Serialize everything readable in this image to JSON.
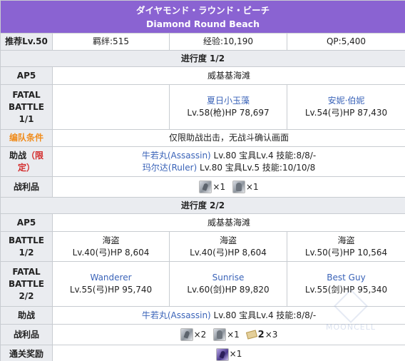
{
  "header": {
    "title_jp": "ダイヤモンド・ラウンド・ビーチ",
    "title_en": "Diamond Round Beach"
  },
  "summary": {
    "recommended_level": "推荐Lv.50",
    "bond": "羁绊:515",
    "exp": "经验:10,190",
    "qp": "QP:5,400"
  },
  "progress1": {
    "title": "进行度 1/2",
    "ap_label": "AP5",
    "location": "威基基海滩",
    "battle_label": [
      "FATAL",
      "BATTLE",
      "1/1"
    ],
    "enemies": [
      {
        "name": "",
        "stats": ""
      },
      {
        "name": "夏日小玉藻",
        "stats": "Lv.58(枪)HP 78,697"
      },
      {
        "name": "安妮·伯妮",
        "stats": "Lv.54(弓)HP 87,430"
      }
    ],
    "formation_label": "编队条件",
    "formation_value": "仅限助战出击，无战斗确认画面",
    "support_label_a": "助战",
    "support_label_b": "（限",
    "support_label_c": "定）",
    "support_lines": [
      {
        "name": "牛若丸(Assassin)",
        "rest": " Lv.80 宝具Lv.4 技能:8/8/-"
      },
      {
        "name": "玛尔达(Ruler)",
        "rest": " Lv.80 宝具Lv.5 技能:10/10/8"
      }
    ],
    "loot_label": "战利品",
    "loot": [
      {
        "icon": "silver-gear-icon",
        "count": "×1"
      },
      {
        "icon": "silver-statue-icon",
        "count": "×1"
      }
    ]
  },
  "progress2": {
    "title": "进行度 2/2",
    "ap_label": "AP5",
    "location": "威基基海滩",
    "battle1_label": [
      "BATTLE",
      "1/2"
    ],
    "battle1_enemies": [
      {
        "name": "海盗",
        "stats": "Lv.40(弓)HP 8,604"
      },
      {
        "name": "海盗",
        "stats": "Lv.40(弓)HP 8,604"
      },
      {
        "name": "海盗",
        "stats": "Lv.50(弓)HP 10,564"
      }
    ],
    "battle2_label": [
      "FATAL",
      "BATTLE",
      "2/2"
    ],
    "battle2_enemies": [
      {
        "name": "Wanderer",
        "stats": "Lv.55(弓)HP 95,740"
      },
      {
        "name": "Sunrise",
        "stats": "Lv.60(剑)HP 89,820"
      },
      {
        "name": "Best Guy",
        "stats": "Lv.55(剑)HP 95,340"
      }
    ],
    "support_label": "助战",
    "support_line": {
      "name": "牛若丸(Assassin)",
      "rest": " Lv.80 宝具Lv.4 技能:8/8/-"
    },
    "loot_label": "战利品",
    "loot": [
      {
        "icon": "silver-gear-icon",
        "count": "×2"
      },
      {
        "icon": "silver-statue-icon",
        "count": "×1"
      },
      {
        "icon": "craft-card-icon",
        "badge": "2",
        "count": "×3"
      }
    ],
    "reward_label": "通关奖励",
    "reward": {
      "icon": "purple-crystal-icon",
      "count": "×1"
    }
  },
  "watermark": "MOONCELL",
  "colors": {
    "header_bg": "#8a63d2",
    "label_bg": "#eaecf0",
    "link_blue": "#3a63b8",
    "orange": "#f08c1c",
    "red": "#d32c2c"
  }
}
